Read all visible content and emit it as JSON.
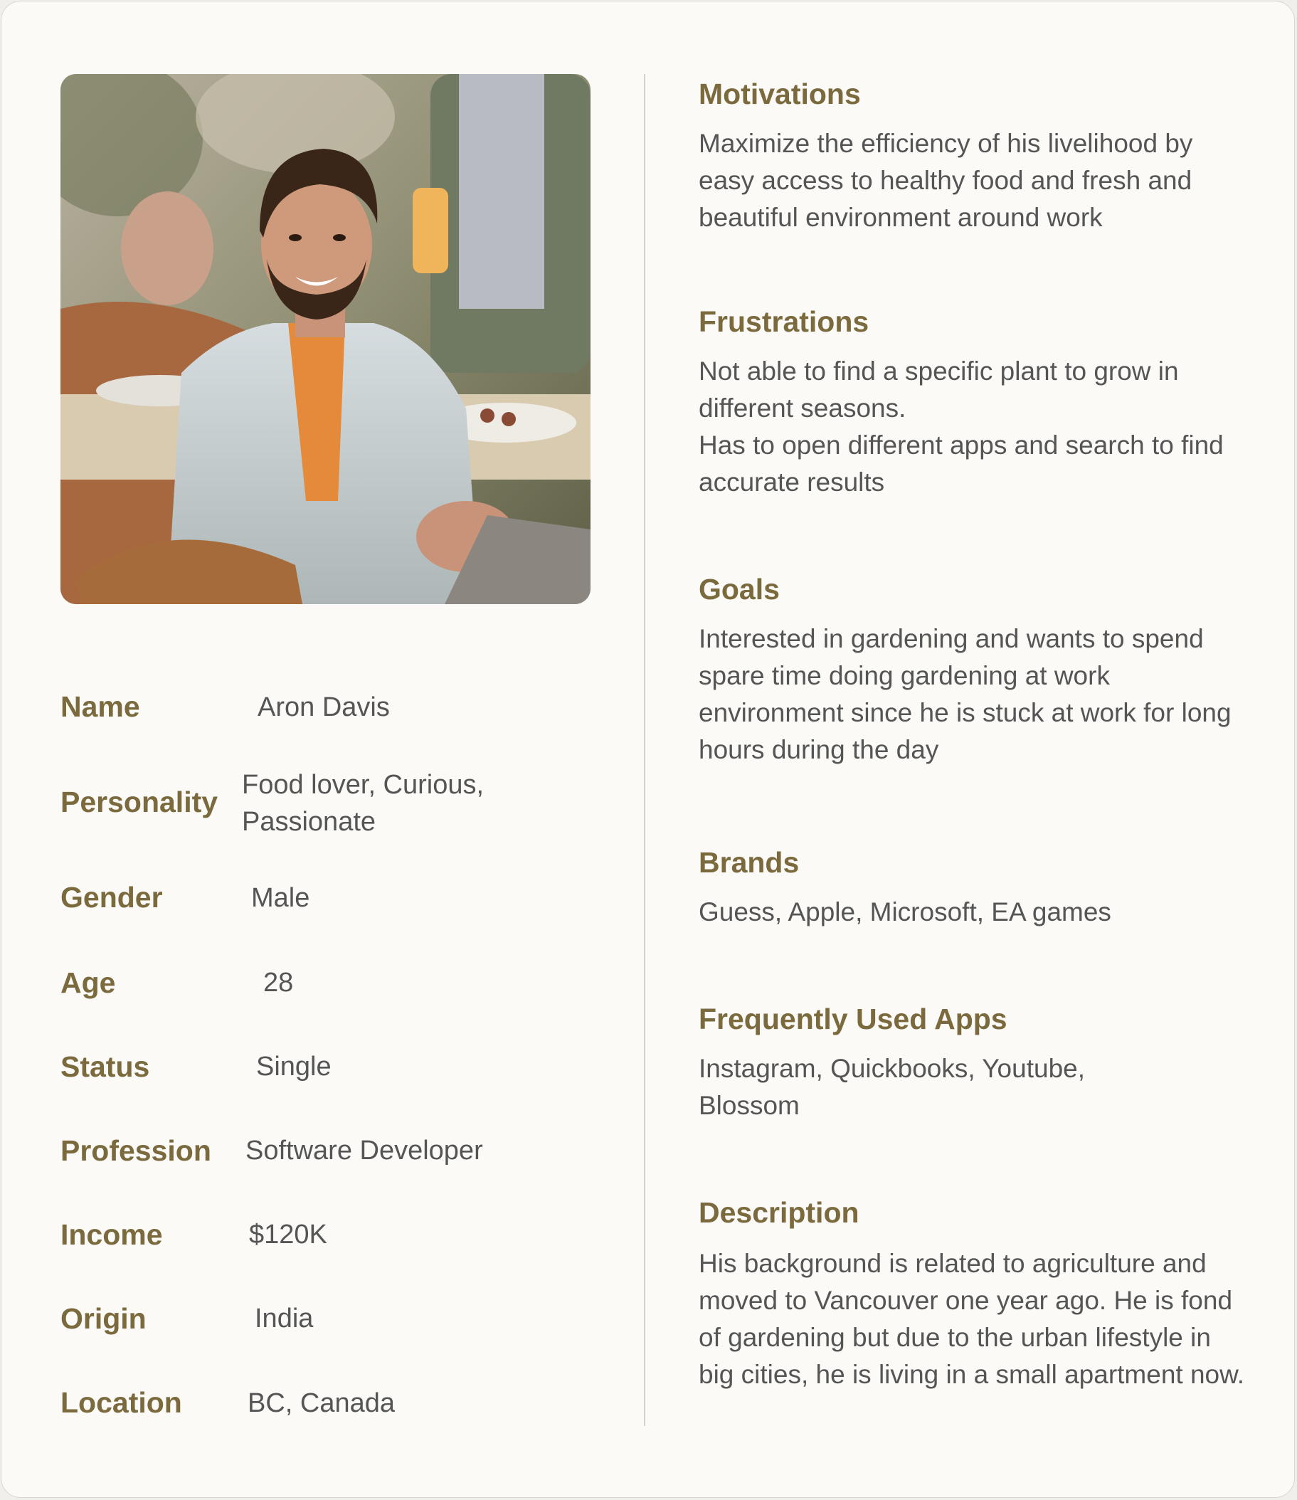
{
  "persona": {
    "attributes": [
      {
        "label": "Name",
        "value": "Aron Davis"
      },
      {
        "label": "Personality",
        "value": "Food lover, Curious, Passionate"
      },
      {
        "label": "Gender",
        "value": "Male"
      },
      {
        "label": "Age",
        "value": "28"
      },
      {
        "label": "Status",
        "value": "Single"
      },
      {
        "label": "Profession",
        "value": "Software Developer"
      },
      {
        "label": "Income",
        "value": "$120K"
      },
      {
        "label": "Origin",
        "value": "India"
      },
      {
        "label": "Location",
        "value": "BC, Canada"
      }
    ],
    "sections": [
      {
        "heading": "Motivations",
        "body": [
          "Maximize the efficiency of his livelihood by easy access to healthy food and fresh and beautiful environment around work"
        ]
      },
      {
        "heading": "Frustrations",
        "body": [
          "Not able to find a specific plant to grow in different seasons.",
          "Has to open different apps and search to find accurate results"
        ]
      },
      {
        "heading": "Goals",
        "body": [
          "Interested in gardening and wants to spend spare time doing gardening at work environment since he is stuck at work for long hours during the day"
        ]
      },
      {
        "heading": "Brands",
        "body": [
          "Guess, Apple, Microsoft, EA games"
        ]
      },
      {
        "heading": "Frequently Used Apps",
        "body": [
          "Instagram, Quickbooks, Youtube, Blossom"
        ]
      },
      {
        "heading": "Description",
        "body": [
          "His background is related to agriculture and moved to Vancouver one year ago. He is fond of gardening but due to the urban lifestyle in big cities, he is living in a small apartment now."
        ]
      }
    ]
  }
}
